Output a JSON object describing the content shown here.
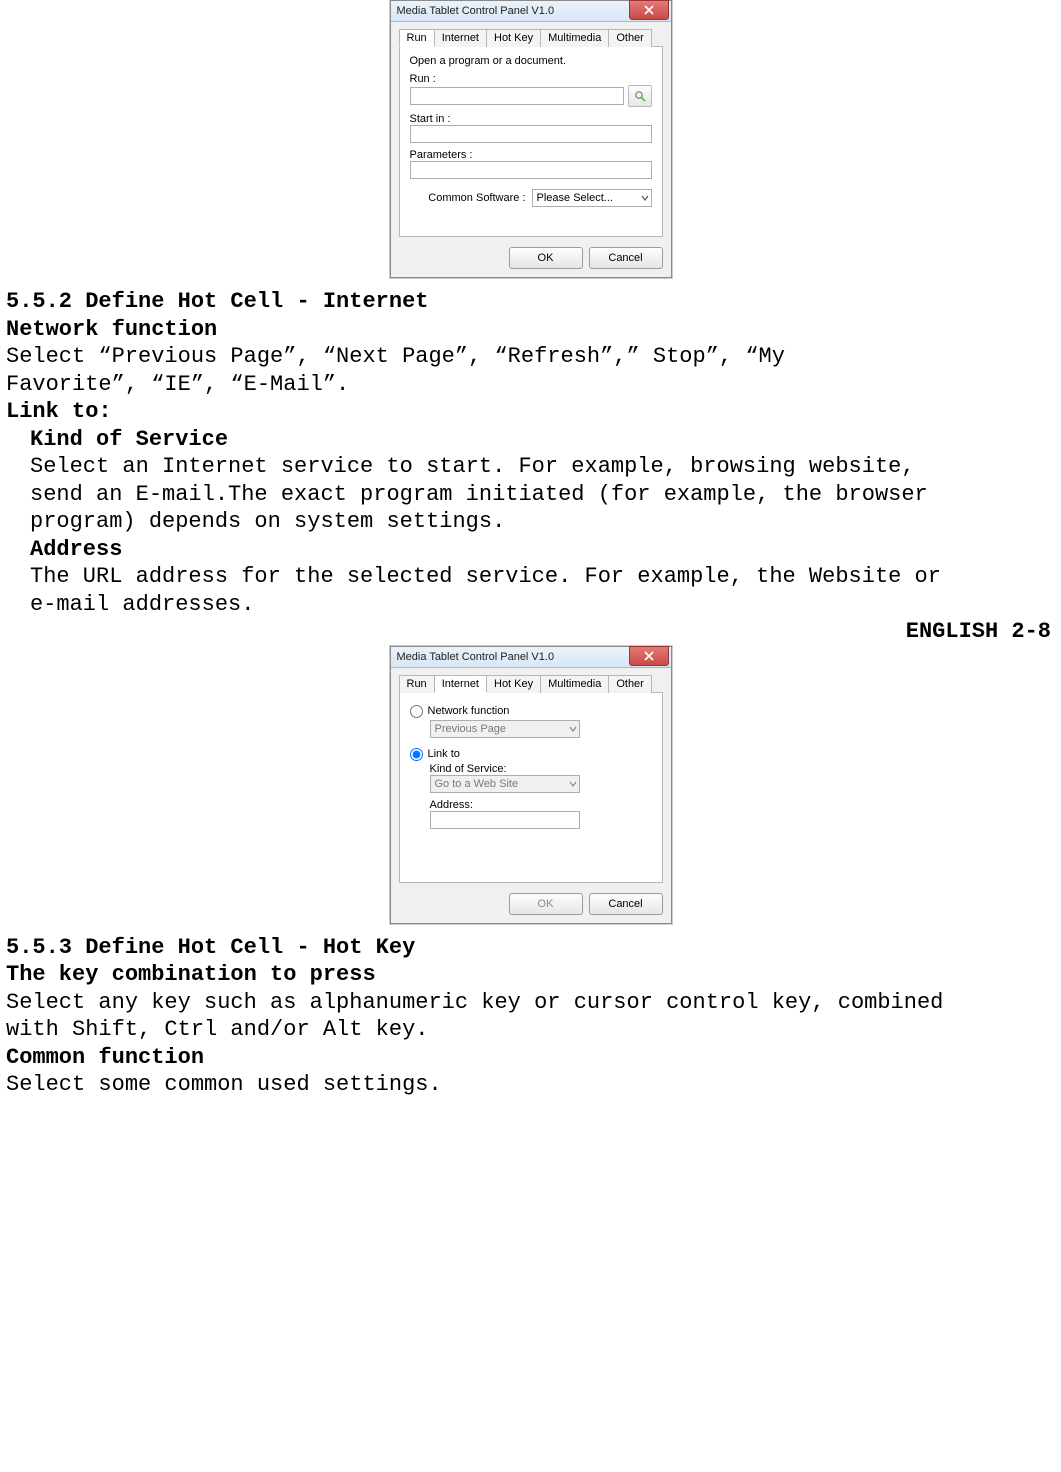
{
  "dialog1": {
    "title": "Media Tablet Control Panel V1.0",
    "tabs": [
      "Run",
      "Internet",
      "Hot Key",
      "Multimedia",
      "Other"
    ],
    "active_tab": "Run",
    "open_hint": "Open a program or a document.",
    "run_label": "Run :",
    "run_value": "",
    "startin_label": "Start in :",
    "startin_value": "",
    "params_label": "Parameters :",
    "params_value": "",
    "common_label": "Common Software :",
    "common_value": "Please Select...",
    "ok": "OK",
    "cancel": "Cancel"
  },
  "sec552": {
    "h1": "5.5.2 Define Hot Cell - Internet",
    "h2": "Network function",
    "p1a": "Select “Previous Page”, “Next Page”, “Refresh”,” Stop”, “My",
    "p1b": "Favorite”, “IE”, “E-Mail”.",
    "h3": "Link to:",
    "h4": "Kind of Service",
    "p2a": "Select an Internet service to start. For example, browsing website,",
    "p2b": "send an E-mail.The exact program initiated (for example, the browser",
    "p2c": "program) depends on system settings.",
    "h5": "Address",
    "p3a": "The URL address for the selected service. For example, the Website or",
    "p3b": "e-mail addresses.",
    "tag": "ENGLISH 2-8"
  },
  "dialog2": {
    "title": "Media Tablet Control Panel V1.0",
    "tabs": [
      "Run",
      "Internet",
      "Hot Key",
      "Multimedia",
      "Other"
    ],
    "active_tab": "Internet",
    "radio1": "Network function",
    "netfunc_value": "Previous Page",
    "radio2": "Link to",
    "kos_label": "Kind of Service:",
    "kos_value": "Go to a Web Site",
    "addr_label": "Address:",
    "addr_value": "",
    "ok": "OK",
    "cancel": "Cancel"
  },
  "sec553": {
    "h1": "5.5.3 Define Hot Cell - Hot Key",
    "h2": "The key combination to press",
    "p1a": "Select any key such as alphanumeric key or cursor control key, combined",
    "p1b": "with Shift, Ctrl and/or Alt key.",
    "h3": "Common function",
    "p2": "Select some common used settings."
  }
}
